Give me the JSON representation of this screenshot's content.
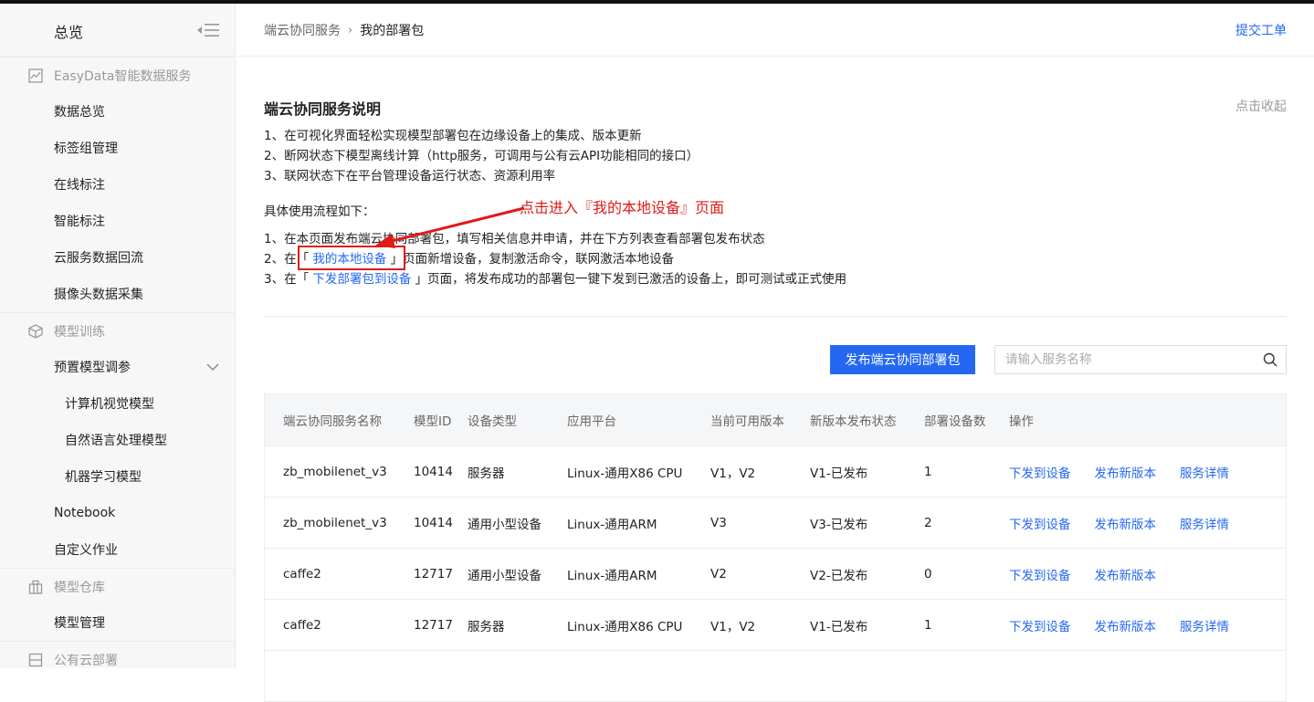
{
  "sidebar": {
    "title": "总览",
    "sections": [
      {
        "label": "EasyData智能数据服务",
        "icon": "chart-icon",
        "items": [
          "数据总览",
          "标签组管理",
          "在线标注",
          "智能标注",
          "云服务数据回流",
          "摄像头数据采集"
        ]
      },
      {
        "label": "模型训练",
        "icon": "cube-icon",
        "items": [
          "预置模型调参",
          "计算机视觉模型",
          "自然语言处理模型",
          "机器学习模型",
          "Notebook",
          "自定义作业"
        ]
      },
      {
        "label": "模型仓库",
        "icon": "warehouse-icon",
        "items": [
          "模型管理"
        ]
      },
      {
        "label": "公有云部署",
        "icon": "deploy-icon",
        "items": []
      }
    ]
  },
  "breadcrumb": {
    "parent": "端云协同服务",
    "separator": "›",
    "current": "我的部署包"
  },
  "header": {
    "ticket": "提交工单"
  },
  "description": {
    "title": "端云协同服务说明",
    "collapse": "点击收起",
    "lines": [
      "1、在可视化界面轻松实现模型部署包在边缘设备上的集成、版本更新",
      "2、断网状态下模型离线计算（http服务，可调用与公有云API功能相同的接口）",
      "3、联网状态下在平台管理设备运行状态、资源利用率"
    ],
    "flow_title": "具体使用流程如下：",
    "flow": {
      "line1": "1、在本页面发布端云协同部署包，填写相关信息并申请，并在下方列表查看部署包发布状态",
      "line2_pre": "2、在「 ",
      "line2_link": "我的本地设备",
      "line2_post": " 」页面新增设备，复制激活命令，联网激活本地设备",
      "line3_pre": "3、在「 ",
      "line3_link": "下发部署包到设备",
      "line3_post": " 」页面，将发布成功的部署包一键下发到已激活的设备上，即可测试或正式使用"
    },
    "annotation": "点击进入『我的本地设备』页面"
  },
  "toolbar": {
    "publish_label": "发布端云协同部署包",
    "search_placeholder": "请输入服务名称"
  },
  "table": {
    "columns": [
      "端云协同服务名称",
      "模型ID",
      "设备类型",
      "应用平台",
      "当前可用版本",
      "新版本发布状态",
      "部署设备数",
      "操作"
    ],
    "rows": [
      {
        "name": "zb_mobilenet_v3",
        "model_id": "10414",
        "device_type": "服务器",
        "platform": "Linux-通用X86 CPU",
        "versions": "V1，V2",
        "status": "V1-已发布",
        "devices": "1",
        "ops": [
          "下发到设备",
          "发布新版本",
          "服务详情"
        ]
      },
      {
        "name": "zb_mobilenet_v3",
        "model_id": "10414",
        "device_type": "通用小型设备",
        "platform": "Linux-通用ARM",
        "versions": "V3",
        "status": "V3-已发布",
        "devices": "2",
        "ops": [
          "下发到设备",
          "发布新版本",
          "服务详情"
        ]
      },
      {
        "name": "caffe2",
        "model_id": "12717",
        "device_type": "通用小型设备",
        "platform": "Linux-通用ARM",
        "versions": "V2",
        "status": "V2-已发布",
        "devices": "0",
        "ops": [
          "下发到设备",
          "发布新版本"
        ]
      },
      {
        "name": "caffe2",
        "model_id": "12717",
        "device_type": "服务器",
        "platform": "Linux-通用X86 CPU",
        "versions": "V1，V2",
        "status": "V1-已发布",
        "devices": "1",
        "ops": [
          "下发到设备",
          "发布新版本",
          "服务详情"
        ]
      }
    ]
  },
  "colors": {
    "accent": "#2468f2",
    "annotation": "#e01a1a"
  }
}
